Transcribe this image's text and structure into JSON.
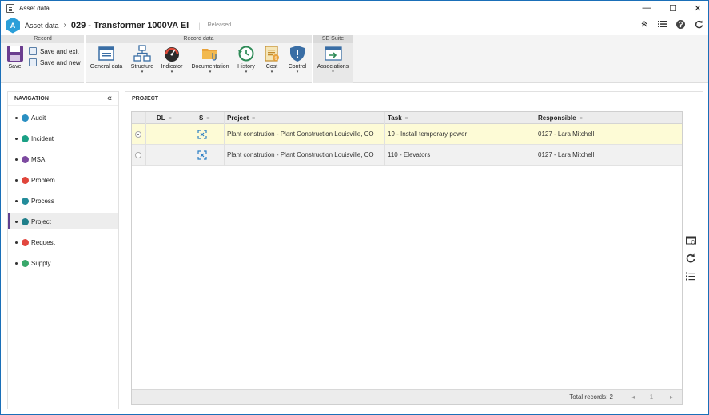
{
  "window": {
    "title": "Asset data",
    "minimize": "—",
    "maximize": "☐",
    "close": "✕"
  },
  "header": {
    "logo_letter": "A",
    "breadcrumb_root": "Asset data",
    "separator": "›",
    "record_title": "029 - Transformer 1000VA EI",
    "pipe": "|",
    "status": "Released"
  },
  "header_icons": [
    "collapse-ribbon-icon",
    "list-icon",
    "help-icon",
    "refresh-icon"
  ],
  "ribbon": {
    "groups": [
      {
        "title": "Record"
      },
      {
        "title": "Record data"
      },
      {
        "title": "SE Suite"
      }
    ],
    "save_label": "Save",
    "save_exit_label": "Save and exit",
    "save_new_label": "Save and new",
    "buttons": [
      {
        "label": "General data"
      },
      {
        "label": "Structure"
      },
      {
        "label": "Indicator"
      },
      {
        "label": "Documentation"
      },
      {
        "label": "History"
      },
      {
        "label": "Cost"
      },
      {
        "label": "Control"
      },
      {
        "label": "Associations"
      }
    ],
    "caret": "▾"
  },
  "navigation": {
    "title": "NAVIGATION",
    "collapse": "«",
    "items": [
      {
        "label": "Audit",
        "color": "#2a8fc2"
      },
      {
        "label": "Incident",
        "color": "#1aa085"
      },
      {
        "label": "MSA",
        "color": "#7d4aa0"
      },
      {
        "label": "Problem",
        "color": "#e0453a"
      },
      {
        "label": "Process",
        "color": "#238c9a"
      },
      {
        "label": "Project",
        "color": "#1f7f8a"
      },
      {
        "label": "Request",
        "color": "#e2473f"
      },
      {
        "label": "Supply",
        "color": "#39a86b"
      }
    ],
    "active_index": 5
  },
  "main": {
    "title": "PROJECT",
    "columns": [
      "DL",
      "S",
      "Project",
      "Task",
      "Responsible"
    ],
    "sort_glyph": "=",
    "rows": [
      {
        "project": "Plant constrution - Plant Construction Louisville, CO",
        "task": "19 - Install temporary power",
        "responsible": "0127 - Lara Mitchell",
        "selected": true
      },
      {
        "project": "Plant constrution - Plant Construction Louisville, CO",
        "task": "110 - Elevators",
        "responsible": "0127 - Lara Mitchell",
        "selected": false
      }
    ],
    "footer": {
      "total": "Total records: 2",
      "prev": "◂",
      "page": "1",
      "next": "▸"
    }
  },
  "colors": {
    "accent": "#1a6fb8",
    "active_nav": "#5f3f8f",
    "selected_row": "#fdfbd6"
  }
}
